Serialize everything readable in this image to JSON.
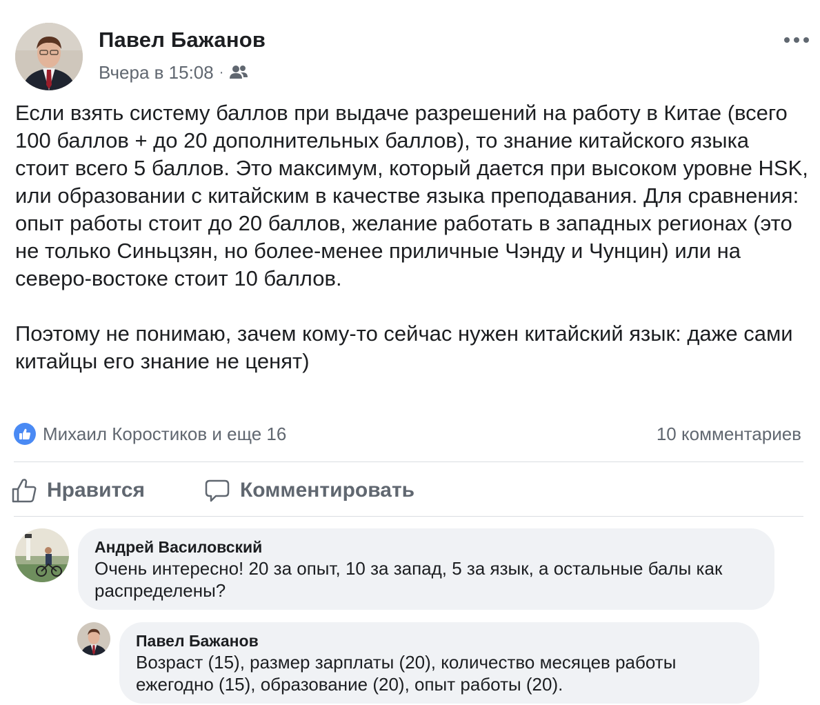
{
  "post": {
    "author": "Павел Бажанов",
    "timestamp": "Вчера в 15:08",
    "separator": "·",
    "audience_icon": "friends-icon",
    "paragraphs": [
      "Если взять систему баллов при выдаче разрешений на работу в Китае (всего 100 баллов + до 20 дополнительных баллов), то знание китайского языка стоит всего 5 баллов. Это максимум, который дается при высоком уровне HSK, или образовании с китайским в качестве языка преподавания. Для сравнения: опыт работы стоит до 20 баллов, желание работать в западных регионах (это не только Синьцзян, но более-менее приличные Чэнду и Чунцин) или на северо-востоке стоит 10 баллов.",
      "Поэтому не понимаю, зачем кому-то сейчас нужен китайский язык: даже сами китайцы его знание не ценят)"
    ]
  },
  "reactions": {
    "icon": "like-icon",
    "summary": "Михаил Коростиков и еще 16",
    "comments_count": "10 комментариев"
  },
  "actions": {
    "like_label": "Нравится",
    "comment_label": "Комментировать"
  },
  "comments": [
    {
      "author": "Андрей Василовский",
      "text": "Очень интересно! 20 за опыт, 10 за запад, 5 за язык, а остальные балы как распределены?"
    },
    {
      "author": "Павел Бажанов",
      "text": "Возраст (15), размер зарплаты (20), количество месяцев работы ежегодно (15), образование (20), опыт работы (20)."
    }
  ],
  "colors": {
    "text": "#1c1e21",
    "secondary": "#606770",
    "like_blue": "#4a8af4",
    "bubble": "#f0f2f5",
    "divider": "#dadde1"
  }
}
